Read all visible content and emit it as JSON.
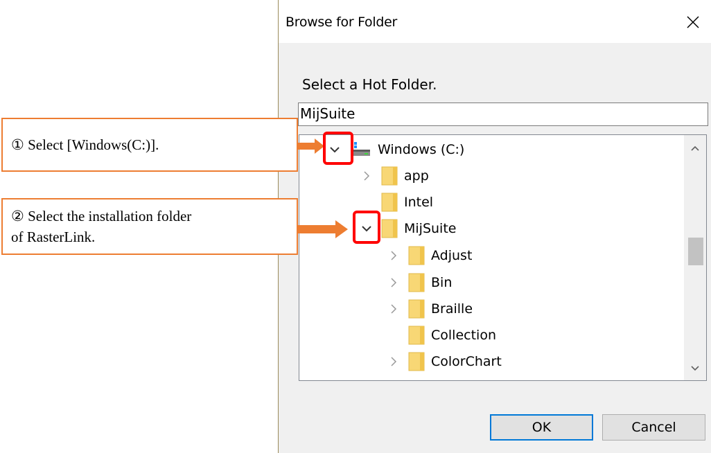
{
  "dialog": {
    "title": "Browse for Folder",
    "instruction": "Select a Hot Folder.",
    "path_value": "MijSuite",
    "ok_label": "OK",
    "cancel_label": "Cancel"
  },
  "tree": {
    "root_label": "Windows (C:)",
    "items": [
      {
        "label": "app",
        "expandable": true
      },
      {
        "label": "Intel",
        "expandable": false
      },
      {
        "label": "MijSuite",
        "expandable": true,
        "expanded": true
      },
      {
        "label": "Adjust",
        "expandable": true
      },
      {
        "label": "Bin",
        "expandable": true
      },
      {
        "label": "Braille",
        "expandable": true
      },
      {
        "label": "Collection",
        "expandable": false
      },
      {
        "label": "ColorChart",
        "expandable": true
      }
    ]
  },
  "callouts": {
    "step1": "① Select [Windows(C:)].",
    "step2_line1": "② Select the installation folder",
    "step2_line2": "of RasterLink."
  },
  "colors": {
    "accent": "#ed7d31",
    "highlight": "#ff0000",
    "folder": "#f8d775",
    "ok_border": "#0078d7"
  }
}
